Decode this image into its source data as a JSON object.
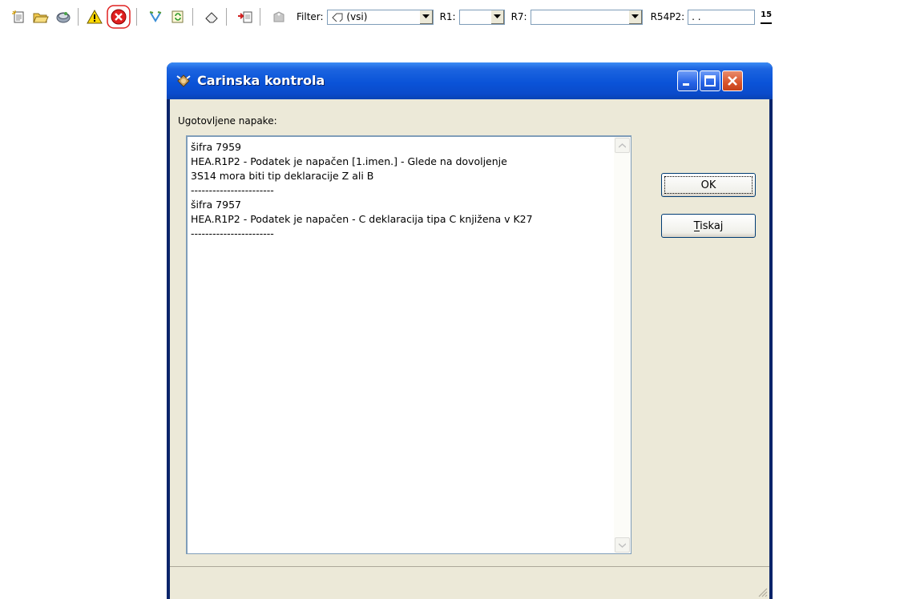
{
  "toolbar": {
    "icons": [
      "new-document-icon",
      "open-folder-icon",
      "settings-icon",
      "warning-icon",
      "error-icon",
      "import-icon",
      "refresh-icon",
      "clear-icon",
      "export-icon",
      "tag-icon"
    ],
    "filter_label": "Filter:",
    "filter_value": "(vsi)",
    "r1_label": "R1:",
    "r1_value": "",
    "r7_label": "R7:",
    "r7_value": "",
    "r54p2_label": "R54P2:",
    "r54p2_value": ". .",
    "calendar_glyph": "15"
  },
  "dialog": {
    "title": "Carinska kontrola",
    "found_label": "Ugotovljene napake:",
    "errors_text": "šifra 7959\nHEA.R1P2 - Podatek je napačen [1.imen.] - Glede na dovoljenje\n3S14 mora biti tip deklaracije Z ali B\n-----------------------\nšifra 7957\nHEA.R1P2 - Podatek je napačen - C deklaracija tipa C knjižena v K27\n-----------------------",
    "ok_label": "OK",
    "print_label": "Tiskaj"
  },
  "colors": {
    "titlebar": "#0a53d8",
    "dialog_bg": "#ece9d8",
    "error_icon": "#e02020",
    "warning_icon": "#ffd800"
  }
}
